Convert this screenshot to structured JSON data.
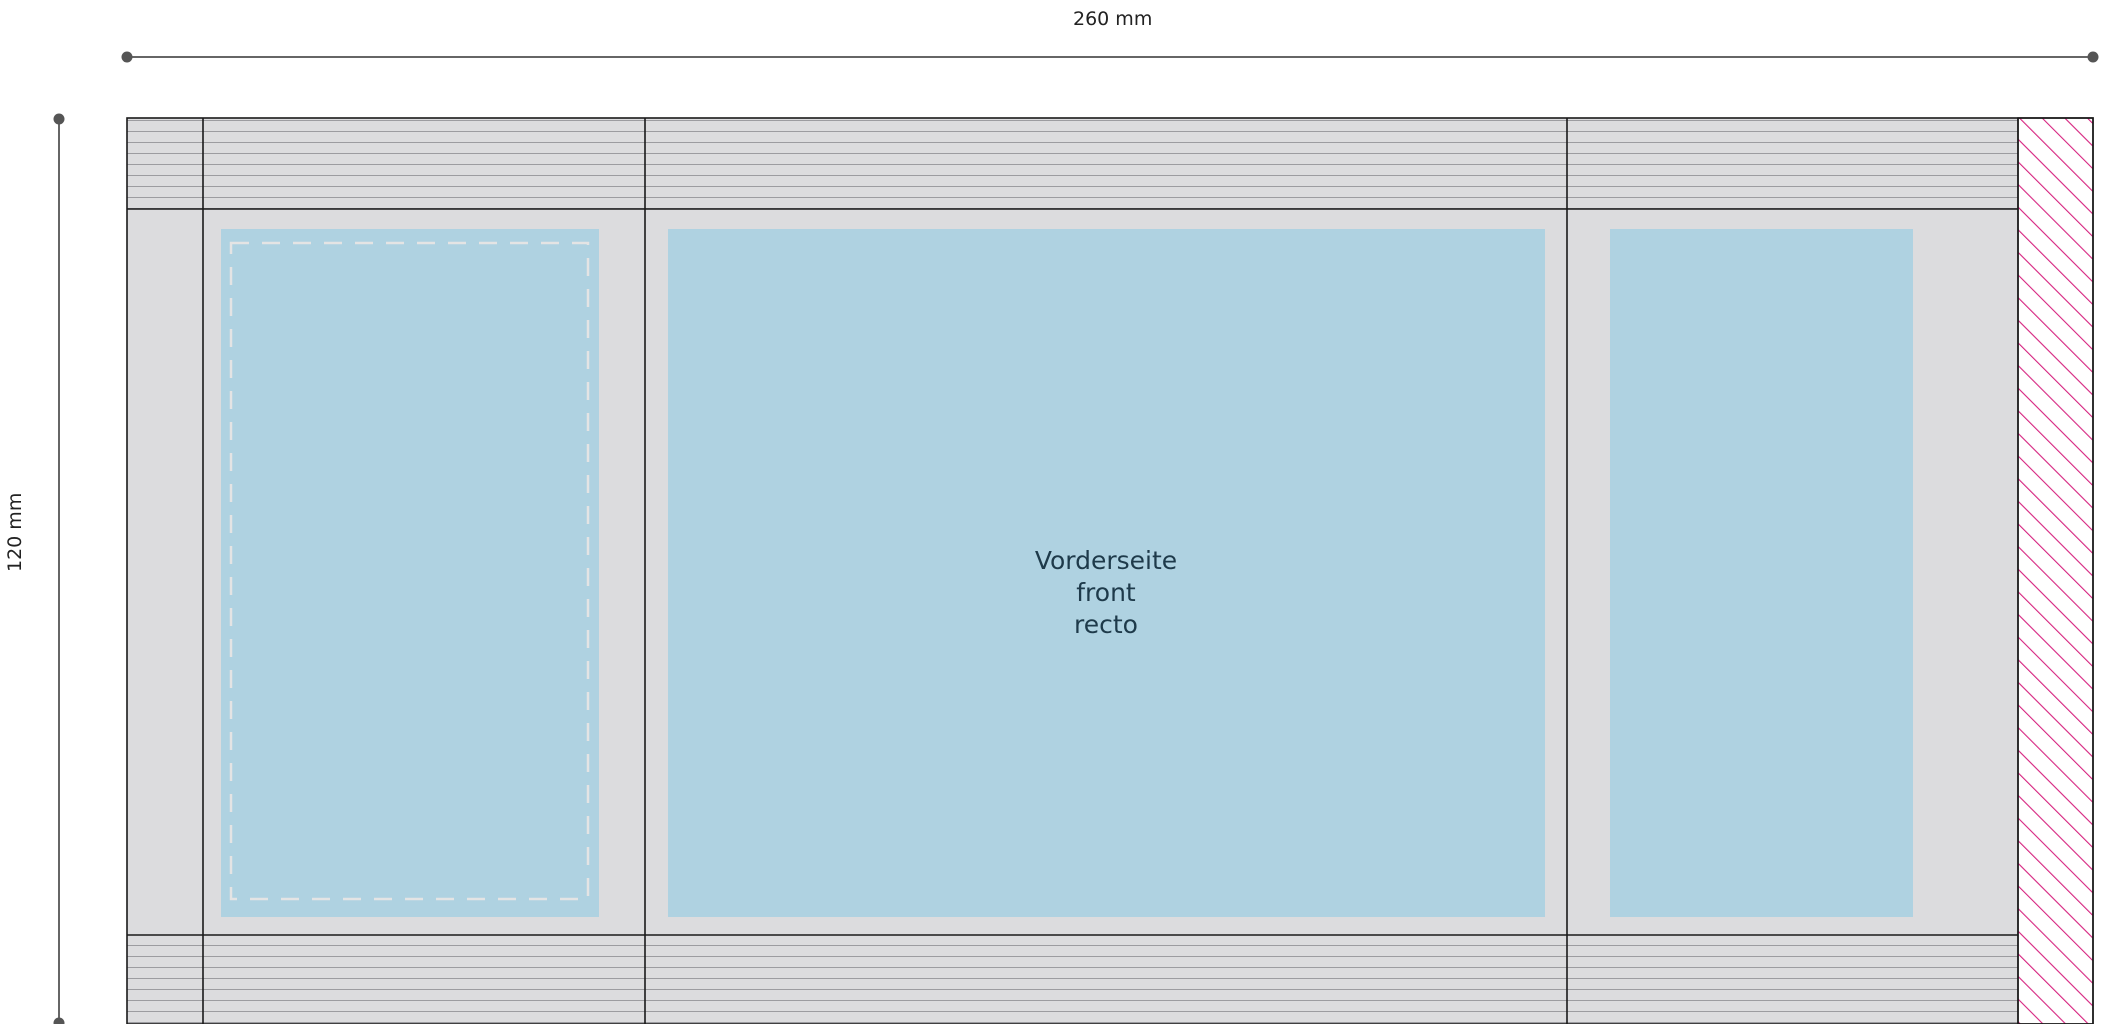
{
  "dimensions": {
    "width_label": "260 mm",
    "height_label": "120 mm"
  },
  "front_panel": {
    "lines": [
      "Vorderseite",
      "front",
      "recto"
    ]
  },
  "colors": {
    "background": "#ffffff",
    "sheet": "#dcdcde",
    "panel": "#afd2e1",
    "hatch": "#d6227f",
    "rule": "#1a1a1a",
    "measure": "#666666",
    "dash": "#e4e4e4"
  }
}
